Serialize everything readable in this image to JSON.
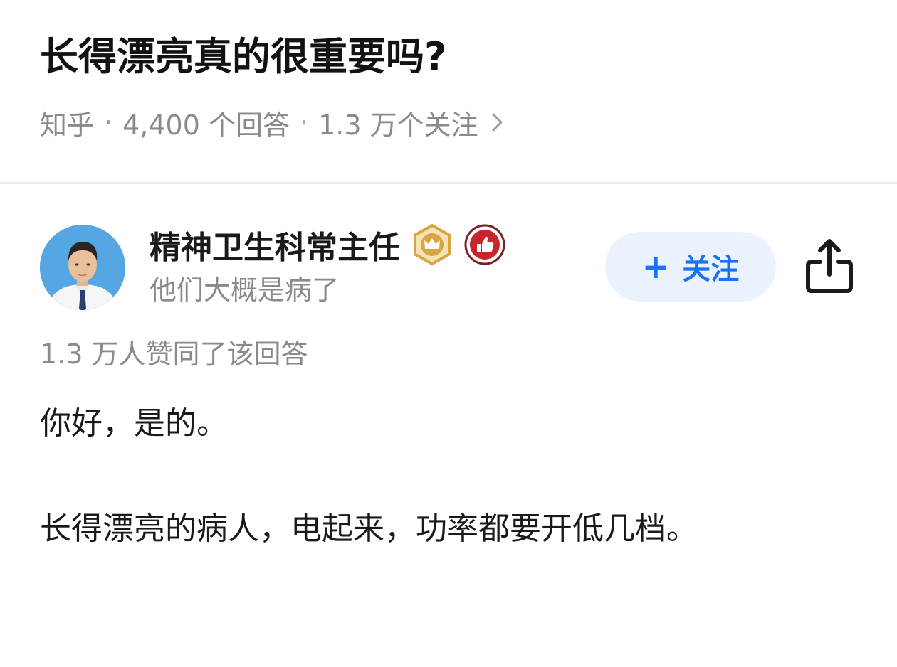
{
  "question": {
    "title": "长得漂亮真的很重要吗?",
    "source": "知乎",
    "answers_count": "4,400 个回答",
    "followers_count": "1.3 万个关注",
    "separator": "·"
  },
  "author": {
    "name": "精神卫生科常主任",
    "bio": "他们大概是病了",
    "badges": [
      "crown-badge-icon",
      "thumbs-up-badge-icon"
    ]
  },
  "follow_button": {
    "plus": "+",
    "label": "关注"
  },
  "answer": {
    "votes": "1.3 万人赞同了该回答",
    "paragraphs": [
      "你好，是的。",
      "长得漂亮的病人，电起来，功率都要开低几档。"
    ]
  },
  "colors": {
    "accent": "#1772f6",
    "follow_bg": "#eaf3fd",
    "meta_gray": "#8a8a8a",
    "badge_gold": "#d9a441",
    "badge_red": "#c8242c"
  }
}
